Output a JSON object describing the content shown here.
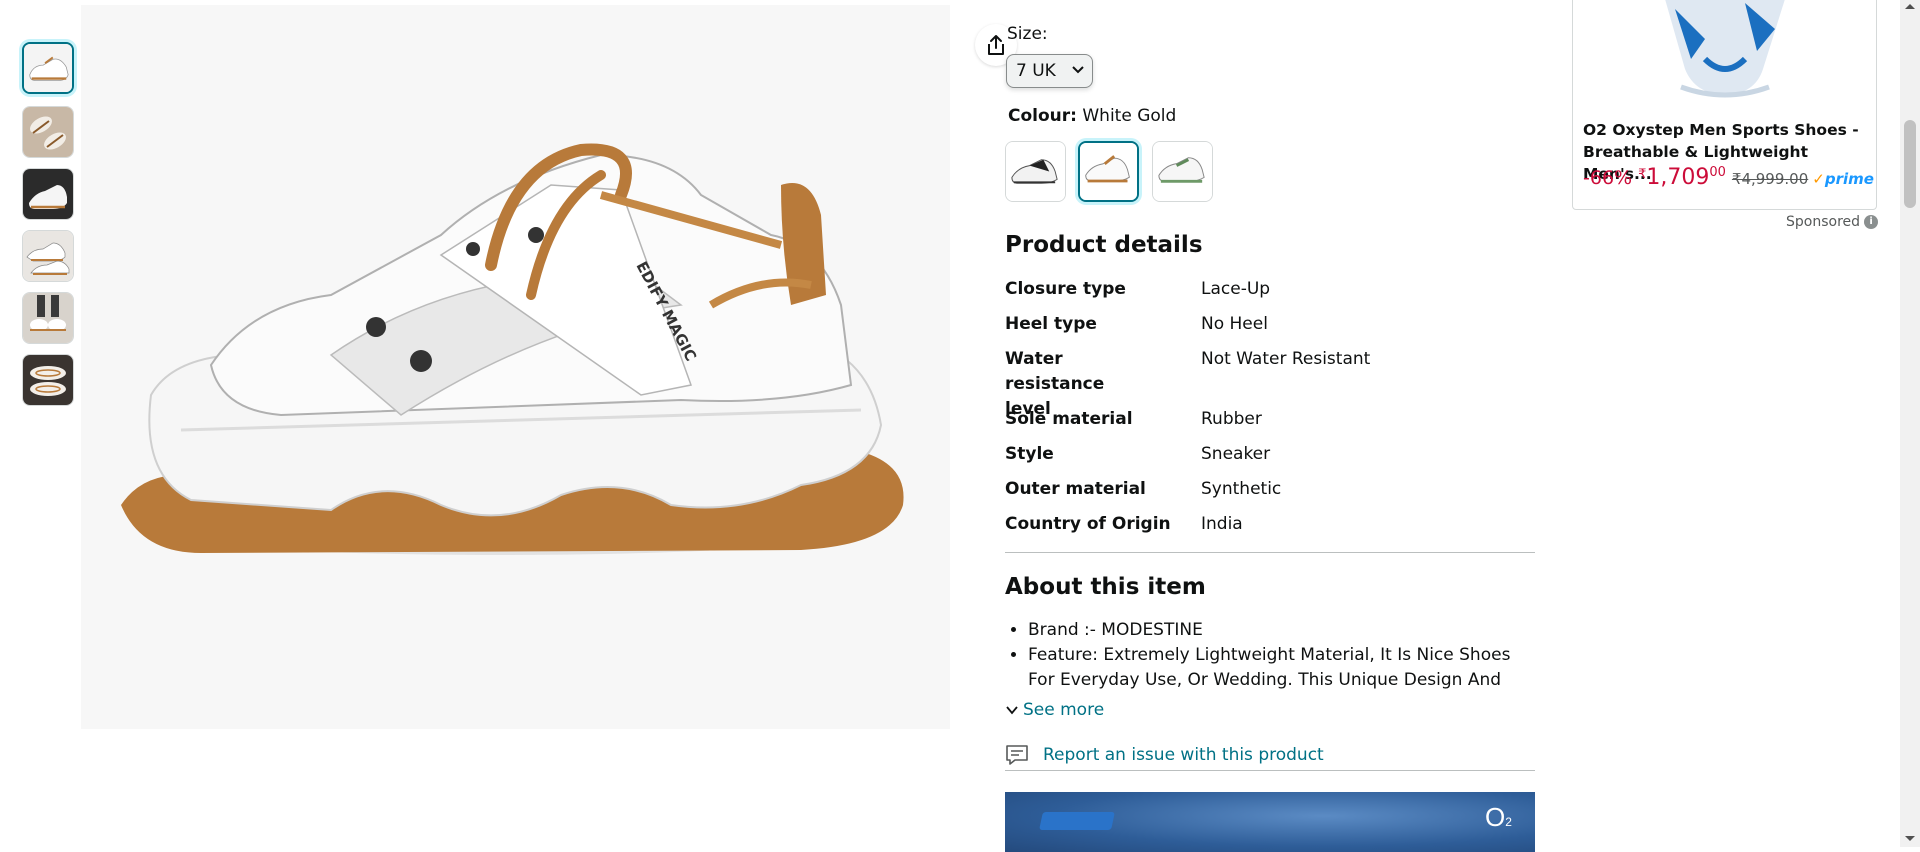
{
  "product": {
    "size_label": "Size:",
    "size_value": "7 UK",
    "colour_label": "Colour:",
    "colour_value": "White Gold",
    "details_heading": "Product details",
    "details": [
      {
        "key": "Closure type",
        "value": "Lace-Up"
      },
      {
        "key": "Heel type",
        "value": "No Heel"
      },
      {
        "key": "Water resistance level",
        "value": "Not Water Resistant"
      },
      {
        "key": "Sole material",
        "value": "Rubber"
      },
      {
        "key": "Style",
        "value": "Sneaker"
      },
      {
        "key": "Outer material",
        "value": "Synthetic"
      },
      {
        "key": "Country of Origin",
        "value": "India"
      }
    ],
    "about_heading": "About this item",
    "about_items": [
      "Brand :- MODESTINE",
      "Feature: Extremely Lightweight Material, It Is Nice Shoes For Everyday Use, Or Wedding. This Unique Design And Stylish"
    ],
    "see_more": "See more",
    "report_issue": "Report an issue with this product",
    "shoe_text": "EDIFY MAGIC"
  },
  "sponsored": {
    "title": "O2 Oxystep Men Sports Shoes - Breathable & Lightweight Men's...",
    "discount": "-66%",
    "currency": "₹",
    "price_whole": "1,709",
    "price_fraction": "00",
    "mrp": "₹4,999.00",
    "prime_check": "✓",
    "prime": "prime",
    "sponsored_label": "Sponsored",
    "info_glyph": "i"
  },
  "banner": {
    "logo": "O",
    "logo_sub": "2"
  },
  "colors": {
    "link": "#007185",
    "accent_border": "#007185",
    "deal_red": "#cc0c39",
    "prime_blue": "#1a98ff",
    "sole_brown": "#b87a3a"
  },
  "icons": {
    "share": "share-icon",
    "chevron": "chevron-down-icon",
    "report": "comment-flag-icon",
    "info": "info-icon"
  }
}
